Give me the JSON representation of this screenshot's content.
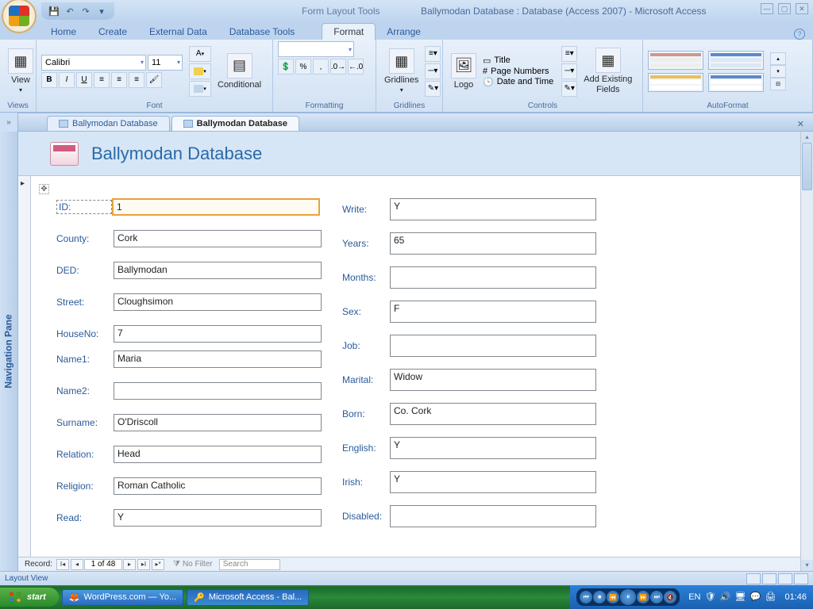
{
  "titlebar": {
    "context_tools": "Form Layout Tools",
    "title": "Ballymodan Database : Database (Access 2007) - Microsoft Access"
  },
  "ribbon_tabs": [
    "Home",
    "Create",
    "External Data",
    "Database Tools",
    "Format",
    "Arrange"
  ],
  "active_ribbon_tab": "Format",
  "ribbon": {
    "views": {
      "label": "Views",
      "view_btn": "View"
    },
    "font": {
      "label": "Font",
      "font_name": "Calibri",
      "font_size": "11",
      "conditional": "Conditional"
    },
    "formatting": {
      "label": "Formatting"
    },
    "gridlines": {
      "label": "Gridlines",
      "btn": "Gridlines"
    },
    "controls": {
      "label": "Controls",
      "logo": "Logo",
      "title": "Title",
      "page_numbers": "Page Numbers",
      "date_time": "Date and Time",
      "add_fields": "Add Existing\nFields"
    },
    "autoformat": {
      "label": "AutoFormat"
    }
  },
  "doc_tabs": [
    {
      "label": "Ballymodan Database",
      "active": false
    },
    {
      "label": "Ballymodan Database",
      "active": true
    }
  ],
  "nav_pane_label": "Navigation Pane",
  "form": {
    "title": "Ballymodan Database",
    "left_fields": [
      {
        "label": "ID:",
        "value": "1",
        "selected": true
      },
      {
        "label": "County:",
        "value": "Cork"
      },
      {
        "label": "DED:",
        "value": "Ballymodan"
      },
      {
        "label": "Street:",
        "value": "Cloughsimon"
      },
      {
        "label": "HouseNo:",
        "value": "7",
        "tight": true
      },
      {
        "label": "Name1:",
        "value": "Maria"
      },
      {
        "label": "Name2:",
        "value": ""
      },
      {
        "label": "Surname:",
        "value": "O'Driscoll"
      },
      {
        "label": "Relation:",
        "value": "Head"
      },
      {
        "label": "Religion:",
        "value": "Roman Catholic"
      },
      {
        "label": "Read:",
        "value": "Y"
      }
    ],
    "right_fields": [
      {
        "label": "Write:",
        "value": "Y"
      },
      {
        "label": "Years:",
        "value": "65"
      },
      {
        "label": "Months:",
        "value": ""
      },
      {
        "label": "Sex:",
        "value": "F"
      },
      {
        "label": "Job:",
        "value": ""
      },
      {
        "label": "Marital:",
        "value": "Widow"
      },
      {
        "label": "Born:",
        "value": "Co. Cork"
      },
      {
        "label": "English:",
        "value": "Y"
      },
      {
        "label": "Irish:",
        "value": "Y"
      },
      {
        "label": "Disabled:",
        "value": ""
      }
    ]
  },
  "recnav": {
    "label": "Record:",
    "position": "1 of 48",
    "filter": "No Filter",
    "search_placeholder": "Search"
  },
  "statusbar": {
    "mode": "Layout View"
  },
  "taskbar": {
    "start": "start",
    "tasks": [
      {
        "label": "WordPress.com — Yo...",
        "active": false
      },
      {
        "label": "Microsoft Access - Bal...",
        "active": true
      }
    ],
    "lang": "EN",
    "clock": "01:46"
  }
}
